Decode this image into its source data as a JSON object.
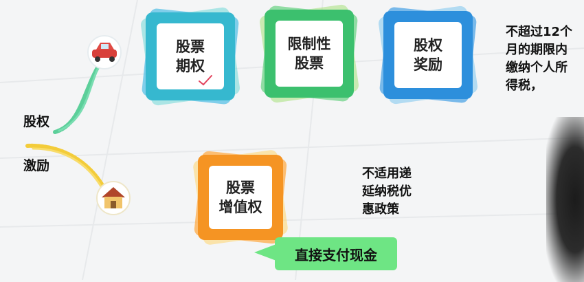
{
  "side_label": {
    "line1": "股权",
    "line2": "激励"
  },
  "tiles": [
    {
      "line1": "股票",
      "line2": "期权",
      "color": "#36b8cf"
    },
    {
      "line1": "限制性",
      "line2": "股票",
      "color": "#3cc06e"
    },
    {
      "line1": "股权",
      "line2": "奖励",
      "color": "#2d8fdc"
    },
    {
      "line1": "股票",
      "line2": "增值权",
      "color": "#f59423"
    }
  ],
  "note_top": [
    "不超过12个",
    "月的期限内",
    "缴纳个人所",
    "得税，"
  ],
  "note_bottom": [
    "不适用递",
    "延纳税优",
    "惠政策"
  ],
  "badge": {
    "label": "直接支付现金",
    "color": "#6ee584"
  },
  "icons": [
    "car-icon",
    "house-icon",
    "checkmark-icon"
  ]
}
